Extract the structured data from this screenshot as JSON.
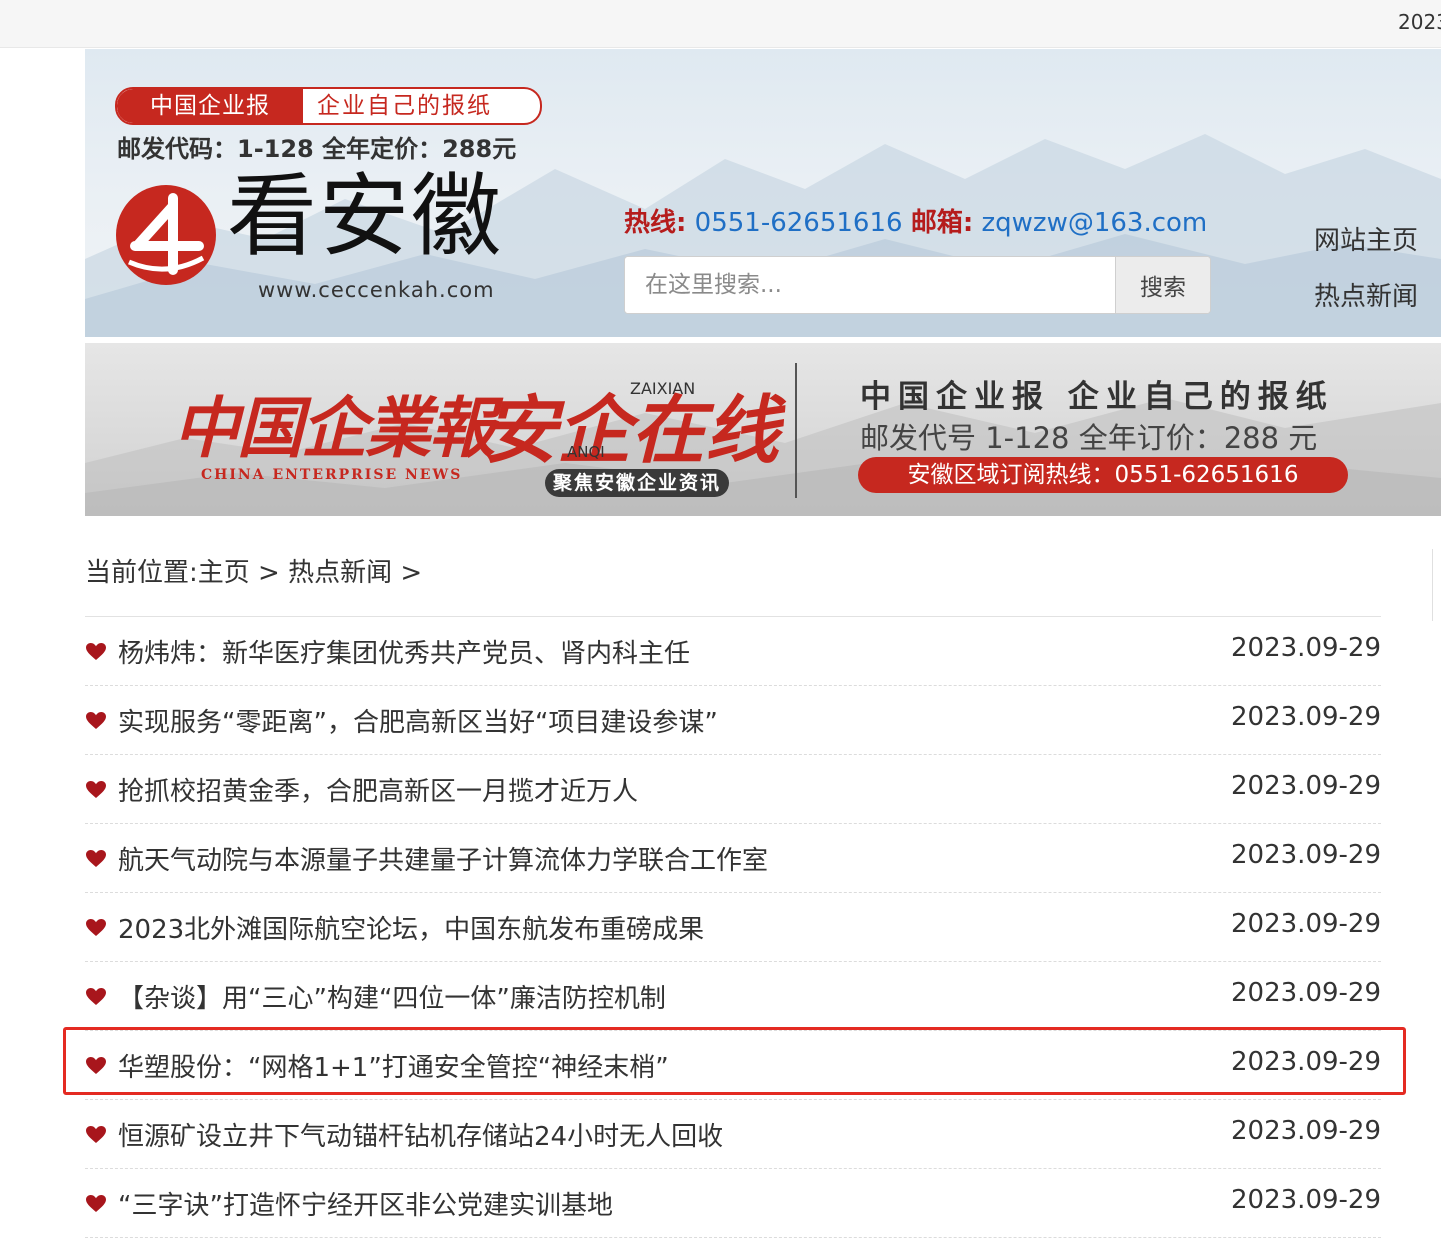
{
  "topbar": {
    "date": "2023"
  },
  "header": {
    "slogan_red": "中国企业报",
    "slogan_white": "企业自己的报纸",
    "postal_line": "邮发代码：1-128 全年定价：288元",
    "logo_text": "看安徽",
    "logo_url": "www.ceccenkah.com",
    "hotline_label": "热线:",
    "hotline_value": "0551-62651616",
    "email_label": "邮箱:",
    "email_value": "zqwzw@163.com",
    "search_placeholder": "在这里搜索...",
    "search_button": "搜索",
    "nav": [
      "网站主页",
      "热点新闻"
    ]
  },
  "banner": {
    "calligraphy": "中国企業報",
    "english": "CHINA ENTERPRISE NEWS",
    "anqi_big": "安企在线",
    "zaixian": "ZAIXIAN",
    "anqi_small": "ANQI",
    "badge": "聚焦安徽企业资讯",
    "right_line1": "中国企业报 企业自己的报纸",
    "right_line2": "邮发代号 1-128 全年订价：288 元",
    "hotline": "安徽区域订阅热线：0551-62651616"
  },
  "breadcrumb": {
    "prefix": "当前位置:",
    "home": "主页",
    "sep1": " > ",
    "section": "热点新闻",
    "sep2": " >"
  },
  "articles": [
    {
      "title": "杨炜炜：新华医疗集团优秀共产党员、肾内科主任",
      "date": "2023.09-29"
    },
    {
      "title": "实现服务“零距离”，合肥高新区当好“项目建设参谋”",
      "date": "2023.09-29"
    },
    {
      "title": "抢抓校招黄金季，合肥高新区一月揽才近万人",
      "date": "2023.09-29"
    },
    {
      "title": "航天气动院与本源量子共建量子计算流体力学联合工作室",
      "date": "2023.09-29"
    },
    {
      "title": "2023北外滩国际航空论坛，中国东航发布重磅成果",
      "date": "2023.09-29"
    },
    {
      "title": "【杂谈】用“三心”构建“四位一体”廉洁防控机制",
      "date": "2023.09-29"
    },
    {
      "title": "华塑股份：“网格1+1”打通安全管控“神经末梢”",
      "date": "2023.09-29"
    },
    {
      "title": "恒源矿设立井下气动锚杆钻机存储站24小时无人回收",
      "date": "2023.09-29"
    },
    {
      "title": "“三字诀”打造怀宁经开区非公党建实训基地",
      "date": "2023.09-29"
    }
  ],
  "icons": {
    "bullet": "heart-icon",
    "logo": "kan-anhui-logo-icon"
  },
  "colors": {
    "brand_red": "#c6281f",
    "link_blue": "#1f6fc5",
    "highlight": "#e42a22"
  }
}
